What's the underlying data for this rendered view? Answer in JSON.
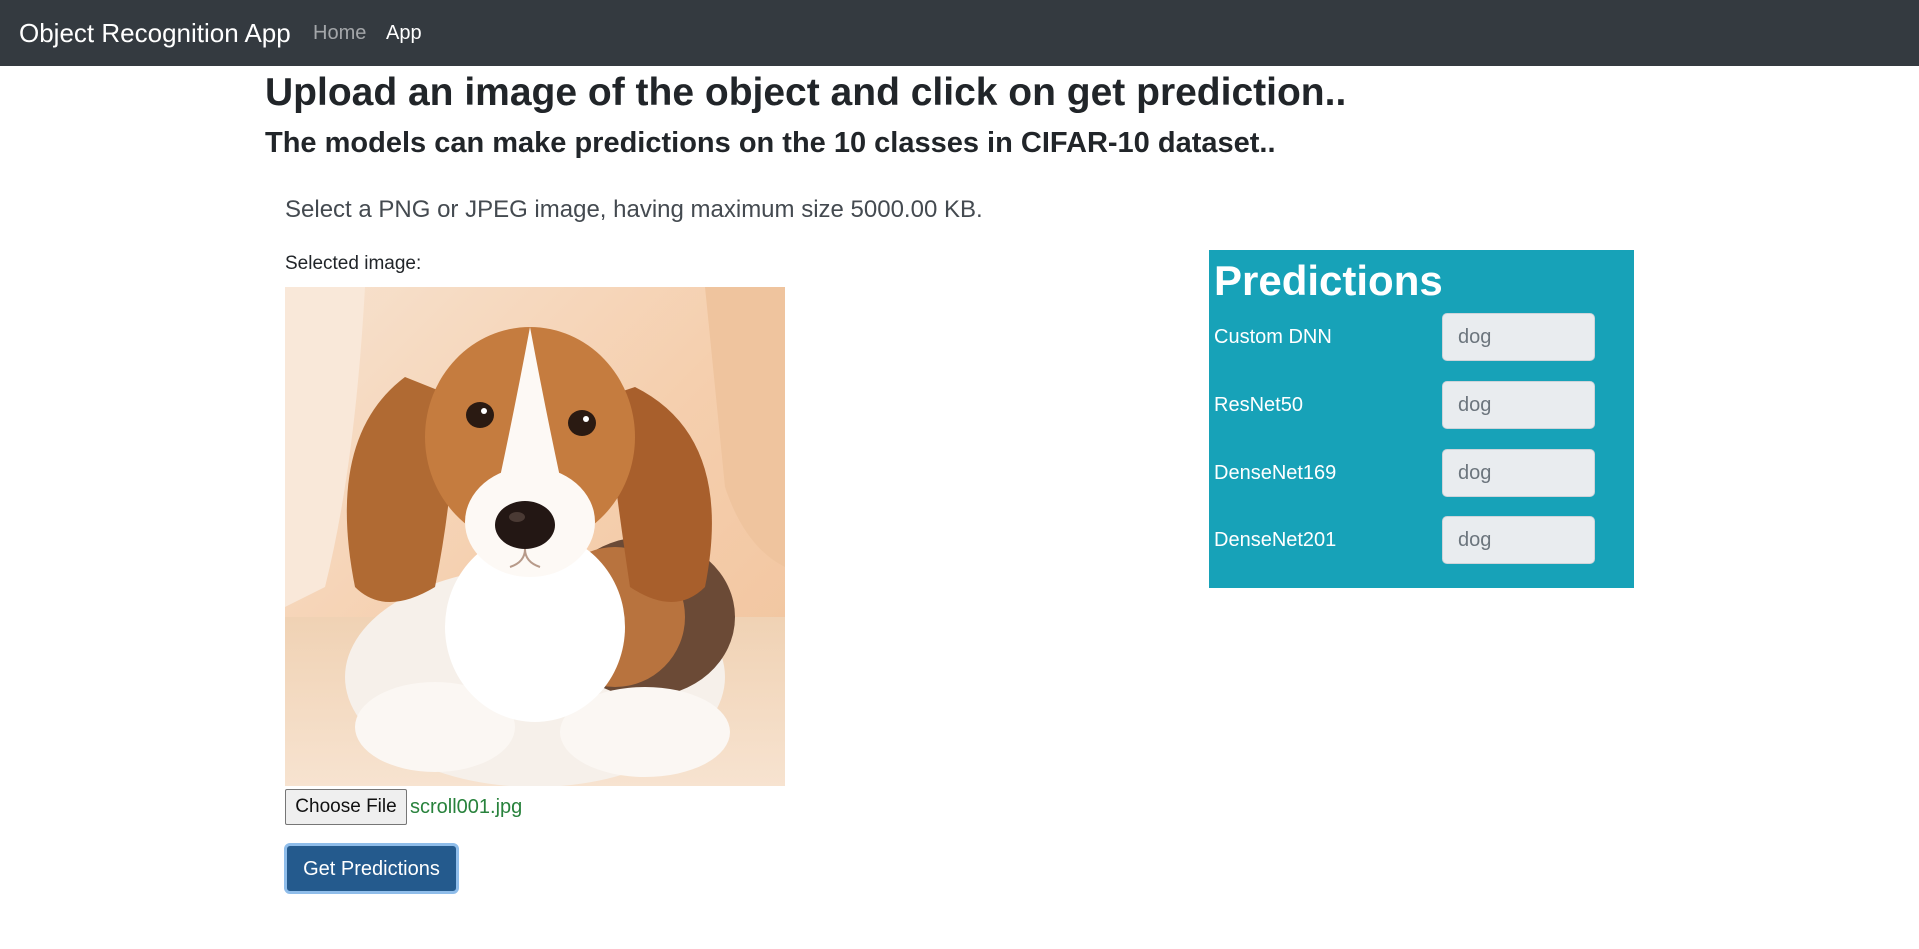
{
  "navbar": {
    "brand": "Object Recognition App",
    "links": [
      {
        "label": "Home",
        "active": false
      },
      {
        "label": "App",
        "active": true
      }
    ]
  },
  "main": {
    "heading": "Upload an image of the object and click on get prediction..",
    "subheading": "The models can make predictions on the 10 classes in CIFAR-10 dataset..",
    "instruction": "Select a PNG or JPEG image, having maximum size 5000.00 KB.",
    "selected_label": "Selected image:",
    "file_input": {
      "button_label": "Choose File",
      "file_name": "scroll001.jpg"
    },
    "submit_label": "Get Predictions"
  },
  "predictions": {
    "title": "Predictions",
    "rows": [
      {
        "model": "Custom DNN",
        "placeholder": "dog"
      },
      {
        "model": "ResNet50",
        "placeholder": "dog"
      },
      {
        "model": "DenseNet169",
        "placeholder": "dog"
      },
      {
        "model": "DenseNet201",
        "placeholder": "dog"
      }
    ]
  },
  "colors": {
    "navbar_bg": "#343a40",
    "panel_bg": "#17a2b8",
    "submit_bg": "#245a8d",
    "file_name": "#28823c"
  }
}
